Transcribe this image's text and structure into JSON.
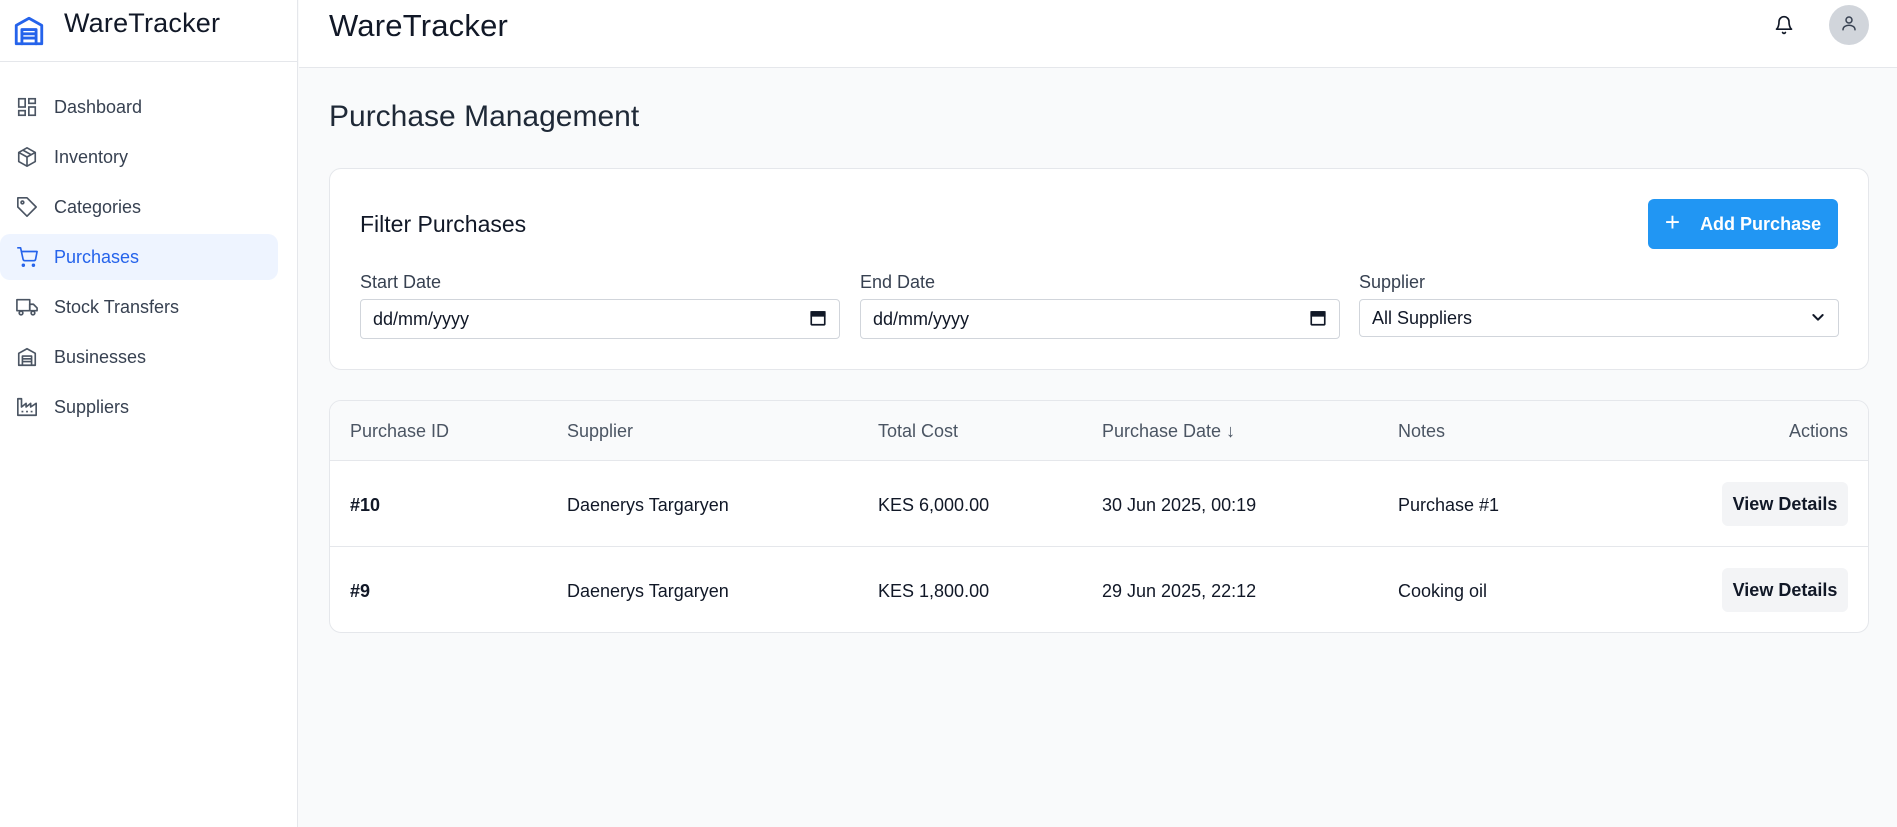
{
  "app": {
    "name": "WareTracker",
    "accent": "#2563eb",
    "button_color": "#2196f3"
  },
  "sidebar": {
    "items": [
      {
        "label": "Dashboard",
        "icon": "dashboard-icon",
        "active": false
      },
      {
        "label": "Inventory",
        "icon": "box-icon",
        "active": false
      },
      {
        "label": "Categories",
        "icon": "tag-icon",
        "active": false
      },
      {
        "label": "Purchases",
        "icon": "cart-icon",
        "active": true
      },
      {
        "label": "Stock Transfers",
        "icon": "truck-icon",
        "active": false
      },
      {
        "label": "Businesses",
        "icon": "warehouse-icon",
        "active": false
      },
      {
        "label": "Suppliers",
        "icon": "factory-icon",
        "active": false
      }
    ]
  },
  "header": {
    "title": "WareTracker",
    "notification_icon": "bell-icon",
    "avatar_icon": "user-icon"
  },
  "main": {
    "page_title": "Purchase Management",
    "filter": {
      "title": "Filter Purchases",
      "add_label": "Add Purchase",
      "start_label": "Start Date",
      "start_placeholder": "dd/mm/yyyy",
      "end_label": "End Date",
      "end_placeholder": "dd/mm/yyyy",
      "supplier_label": "Supplier",
      "supplier_value": "All Suppliers"
    },
    "table": {
      "headers": [
        "Purchase ID",
        "Supplier",
        "Total Cost",
        "Purchase Date ↓",
        "Notes",
        "Actions"
      ],
      "rows": [
        {
          "id": "#10",
          "supplier": "Daenerys Targaryen",
          "total": "KES 6,000.00",
          "date": "30 Jun 2025, 00:19",
          "notes": "Purchase #1",
          "action": "View Details"
        },
        {
          "id": "#9",
          "supplier": "Daenerys Targaryen",
          "total": "KES 1,800.00",
          "date": "29 Jun 2025, 22:12",
          "notes": "Cooking oil",
          "action": "View Details"
        }
      ]
    }
  }
}
